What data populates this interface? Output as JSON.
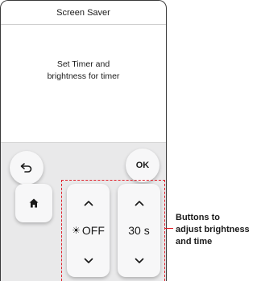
{
  "screen": {
    "title": "Screen Saver",
    "message_line1": "Set Timer and",
    "message_line2": "brightness for timer"
  },
  "controls": {
    "back_icon": "back-arrow-icon",
    "ok_label": "OK",
    "home_icon": "home-icon",
    "brightness": {
      "up_icon": "chevron-up-icon",
      "sun_icon": "☀",
      "value": "OFF",
      "down_icon": "chevron-down-icon"
    },
    "time": {
      "up_icon": "chevron-up-icon",
      "value": "30 s",
      "down_icon": "chevron-down-icon"
    }
  },
  "annotation": {
    "line1": "Buttons to",
    "line2": "adjust brightness",
    "line3": "and time",
    "color": "#e0202a"
  }
}
